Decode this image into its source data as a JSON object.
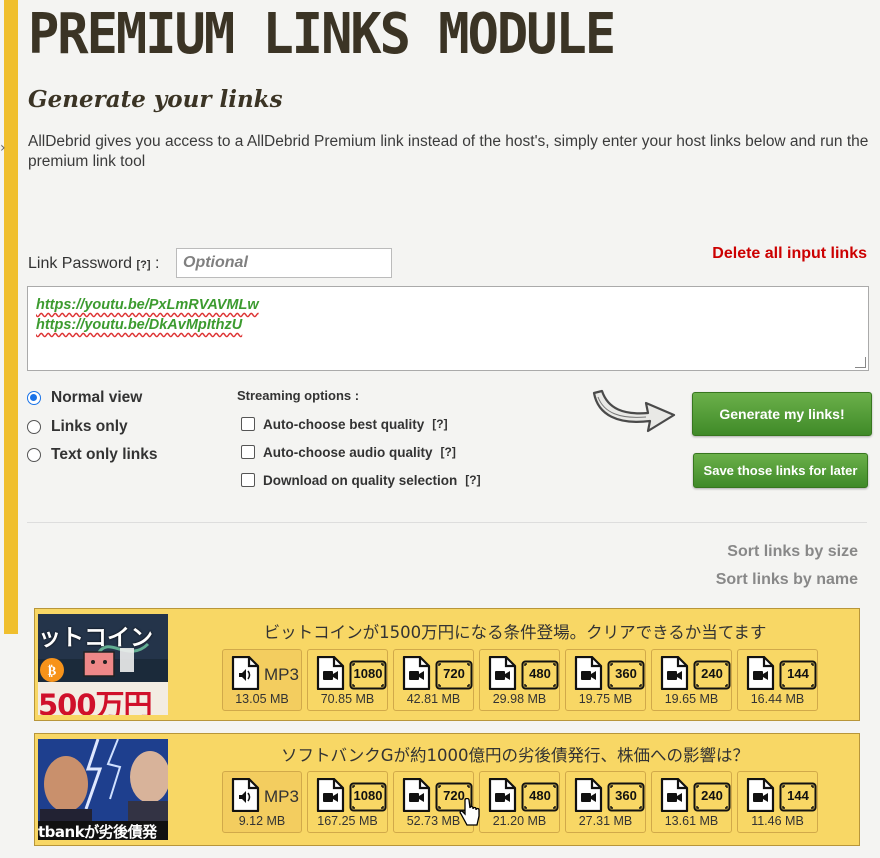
{
  "header": {
    "title": "PREMIUM LINKS MODULE",
    "subtitle": "Generate your links",
    "description": "AllDebrid gives you access to a AllDebrid Premium link instead of the host's, simply enter your host links below and run the premium link tool"
  },
  "form": {
    "password_label": "Link Password",
    "help": "[?]",
    "colon": ":",
    "password_placeholder": "Optional",
    "delete_label": "Delete all input links",
    "links": [
      "https://youtu.be/PxLmRVAVMLw",
      "https://youtu.be/DkAvMpIthzU"
    ]
  },
  "view_options": [
    {
      "label": "Normal view",
      "checked": true
    },
    {
      "label": "Links only",
      "checked": false
    },
    {
      "label": "Text only links",
      "checked": false
    }
  ],
  "streaming": {
    "title": "Streaming options :",
    "options": [
      {
        "label": "Auto-choose best quality",
        "help": "[?]"
      },
      {
        "label": "Auto-choose audio quality",
        "help": "[?]"
      },
      {
        "label": "Download on quality selection",
        "help": "[?]"
      }
    ]
  },
  "buttons": {
    "generate": "Generate my links!",
    "save": "Save those links for later"
  },
  "sort": {
    "by_size": "Sort links by size",
    "by_name": "Sort links by name"
  },
  "results": [
    {
      "title": "ビットコインが1500万円になる条件登場。クリアできるか当てます",
      "thumb_text": "500万円",
      "thumb_top": "ットコイン",
      "formats": [
        {
          "type": "audio",
          "label": "MP3",
          "size": "13.05 MB"
        },
        {
          "type": "video",
          "label": "1080",
          "size": "70.85 MB"
        },
        {
          "type": "video",
          "label": "720",
          "size": "42.81 MB"
        },
        {
          "type": "video",
          "label": "480",
          "size": "29.98 MB"
        },
        {
          "type": "video",
          "label": "360",
          "size": "19.75 MB"
        },
        {
          "type": "video",
          "label": "240",
          "size": "19.65 MB"
        },
        {
          "type": "video",
          "label": "144",
          "size": "16.44 MB"
        }
      ]
    },
    {
      "title": "ソフトバンクGが約1000億円の劣後債発行、株価への影響は？",
      "thumb_text": "tbankが劣後債発",
      "formats": [
        {
          "type": "audio",
          "label": "MP3",
          "size": "9.12 MB"
        },
        {
          "type": "video",
          "label": "1080",
          "size": "167.25 MB"
        },
        {
          "type": "video",
          "label": "720",
          "size": "52.73 MB"
        },
        {
          "type": "video",
          "label": "480",
          "size": "21.20 MB"
        },
        {
          "type": "video",
          "label": "360",
          "size": "27.31 MB"
        },
        {
          "type": "video",
          "label": "240",
          "size": "13.61 MB"
        },
        {
          "type": "video",
          "label": "144",
          "size": "11.46 MB"
        }
      ]
    }
  ]
}
